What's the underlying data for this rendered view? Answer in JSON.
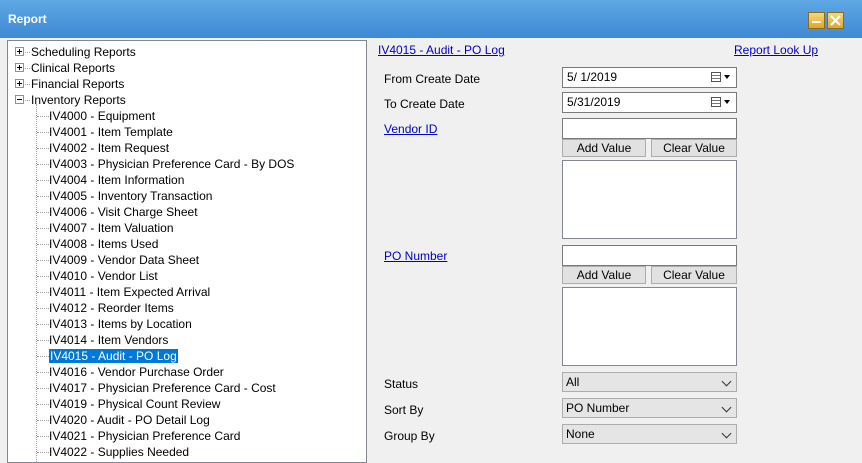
{
  "window": {
    "title": "Report"
  },
  "tree": {
    "groups": [
      {
        "label": "Scheduling Reports",
        "expanded": false
      },
      {
        "label": "Clinical Reports",
        "expanded": false
      },
      {
        "label": "Financial Reports",
        "expanded": false
      },
      {
        "label": "Inventory Reports",
        "expanded": true
      }
    ],
    "items": [
      "IV4000 - Equipment",
      "IV4001 - Item Template",
      "IV4002 - Item Request",
      "IV4003 - Physician Preference Card - By DOS",
      "IV4004 - Item Information",
      "IV4005 - Inventory Transaction",
      "IV4006 - Visit Charge Sheet",
      "IV4007 - Item Valuation",
      "IV4008 - Items Used",
      "IV4009 - Vendor Data Sheet",
      "IV4010 - Vendor List",
      "IV4011 - Item Expected Arrival",
      "IV4012 - Reorder Items",
      "IV4013 - Items by Location",
      "IV4014 - Item Vendors",
      "IV4015 - Audit - PO Log",
      "IV4016 - Vendor Purchase Order",
      "IV4017 - Physician Preference Card - Cost",
      "IV4019 - Physical Count Review",
      "IV4020 - Audit - PO Detail Log",
      "IV4021 - Physician Preference Card",
      "IV4022 - Supplies Needed"
    ],
    "selected_index": 15
  },
  "report": {
    "title": "IV4015 - Audit - PO Log",
    "lookup_link": "Report Look Up",
    "from_create_date": {
      "label": "From Create Date",
      "value": "5/  1/2019"
    },
    "to_create_date": {
      "label": "To Create Date",
      "value": "5/31/2019"
    },
    "vendor_id": {
      "label": "Vendor ID",
      "value": "",
      "add_label": "Add Value",
      "clear_label": "Clear Value"
    },
    "po_number": {
      "label": "PO Number",
      "value": "",
      "add_label": "Add Value",
      "clear_label": "Clear Value"
    },
    "status": {
      "label": "Status",
      "value": "All"
    },
    "sort_by": {
      "label": "Sort By",
      "value": "PO Number"
    },
    "group_by": {
      "label": "Group By",
      "value": "None"
    }
  }
}
